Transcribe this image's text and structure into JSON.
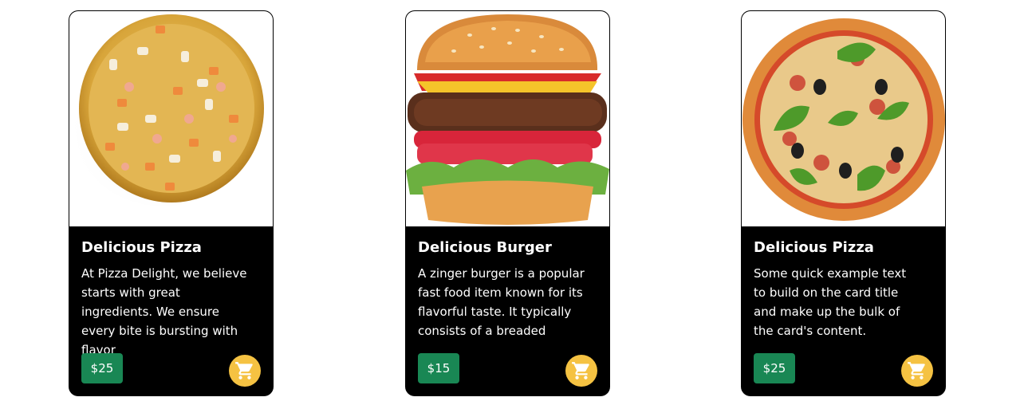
{
  "cards": [
    {
      "title": "Delicious Pizza",
      "text": "At Pizza Delight, we believe starts with great ingredients. We ensure every bite is bursting with flavor",
      "price": "$25",
      "image_icon": "seafood-pizza-image",
      "cart_icon": "cart-icon"
    },
    {
      "title": "Delicious Burger",
      "text": "A zinger burger is a popular fast food item known for its flavorful taste. It typically consists of a breaded",
      "price": "$15",
      "image_icon": "burger-image",
      "cart_icon": "cart-icon"
    },
    {
      "title": "Delicious Pizza",
      "text": "Some quick example text to build on the card title and make up the bulk of the card's content.",
      "price": "$25",
      "image_icon": "margherita-pizza-image",
      "cart_icon": "cart-icon"
    }
  ],
  "colors": {
    "card_bg": "#000000",
    "price_button": "#198754",
    "cart_button": "#f5c242",
    "text": "#ffffff"
  }
}
